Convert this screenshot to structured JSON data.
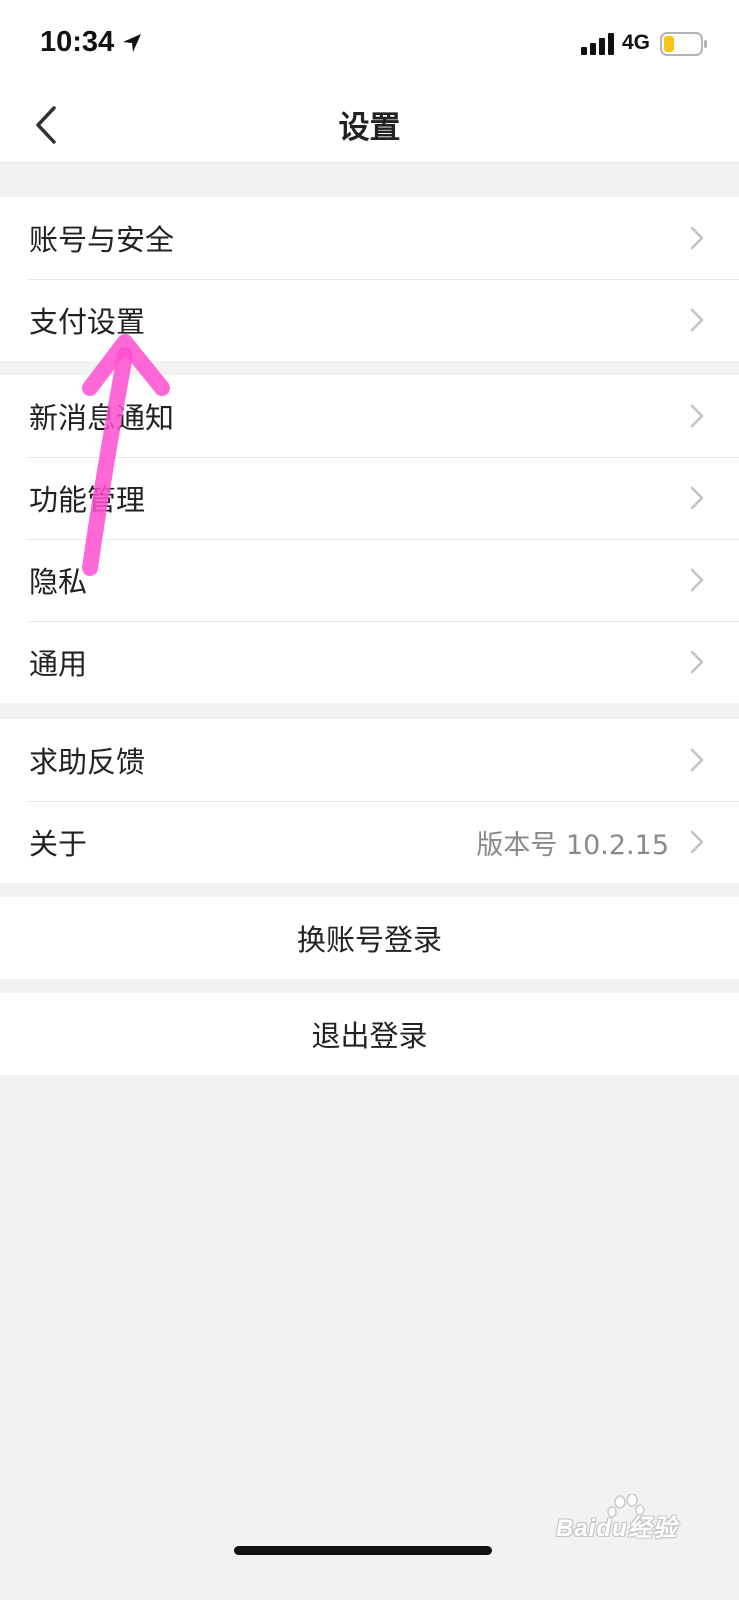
{
  "status_bar": {
    "time": "10:34",
    "network": "4G",
    "icons": [
      "location-arrow-icon",
      "signal-icon",
      "battery-icon"
    ],
    "battery_color": "#f5c518"
  },
  "nav": {
    "title": "设置",
    "back_icon": "chevron-left-icon"
  },
  "groups": [
    {
      "items": [
        {
          "label": "账号与安全"
        },
        {
          "label": "支付设置"
        }
      ]
    },
    {
      "items": [
        {
          "label": "新消息通知"
        },
        {
          "label": "功能管理"
        },
        {
          "label": "隐私"
        },
        {
          "label": "通用"
        }
      ]
    },
    {
      "items": [
        {
          "label": "求助反馈"
        },
        {
          "label": "关于",
          "value": "版本号 10.2.15"
        }
      ]
    }
  ],
  "actions": {
    "switch_account": "换账号登录",
    "logout": "退出登录"
  },
  "annotation": {
    "icon": "arrow-up-icon",
    "color": "#ff4fd0"
  },
  "watermark": {
    "text": "Baidu经验"
  },
  "colors": {
    "background": "#f2f2f2",
    "surface": "#ffffff",
    "divider": "#e6e6e6",
    "secondary_text": "#8a8a8a"
  }
}
